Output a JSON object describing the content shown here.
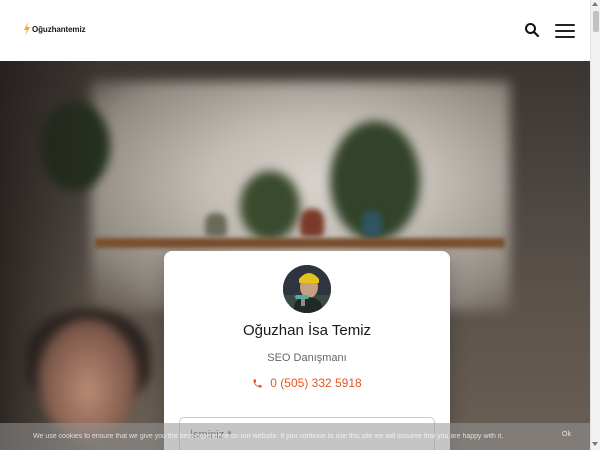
{
  "header": {
    "logo_text": "Oğuzhantemiz",
    "accent_color": "#f5a623",
    "search_icon": "search-icon",
    "menu_icon": "hamburger-menu-icon"
  },
  "profile_card": {
    "name": "Oğuzhan İsa Temiz",
    "role": "SEO Danışmanı",
    "phone": "0 (505) 332 5918",
    "phone_icon": "phone-icon",
    "phone_color": "#e8541e",
    "form": {
      "name_placeholder": "İsminiz *",
      "name_value": ""
    }
  },
  "cookie_bar": {
    "text": "We use cookies to ensure that we give you the best experience on our website. If you continue to use this site we will assume that you are happy with it.",
    "accept_label": "Ok"
  }
}
